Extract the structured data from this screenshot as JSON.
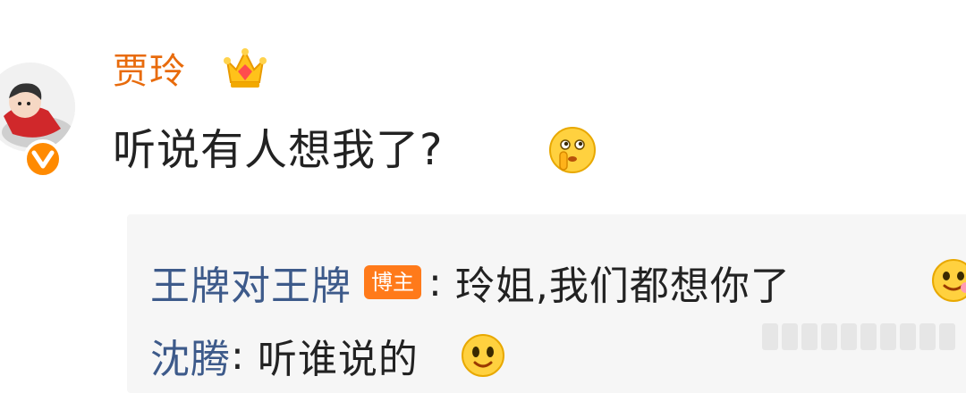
{
  "post": {
    "author": "贾玲",
    "text": "听说有人想我了?",
    "verified_badge": "V",
    "author_icon": "crown-icon",
    "text_emoji": "thinking-shush-emoji"
  },
  "replies": [
    {
      "name": "王牌对王牌",
      "tag": "博主",
      "separator": ":",
      "text": "玲姐,我们都想你了",
      "emoji": "blush-emoji"
    },
    {
      "name": "沈腾",
      "separator": ":",
      "text": "听谁说的",
      "emoji": "smile-emoji"
    }
  ],
  "colors": {
    "author": "#e86b0c",
    "reply_name": "#3d5a8a",
    "blogger_tag": "#ff7a1a",
    "badge": "#ff8a00",
    "reply_bg": "#f6f6f6"
  }
}
